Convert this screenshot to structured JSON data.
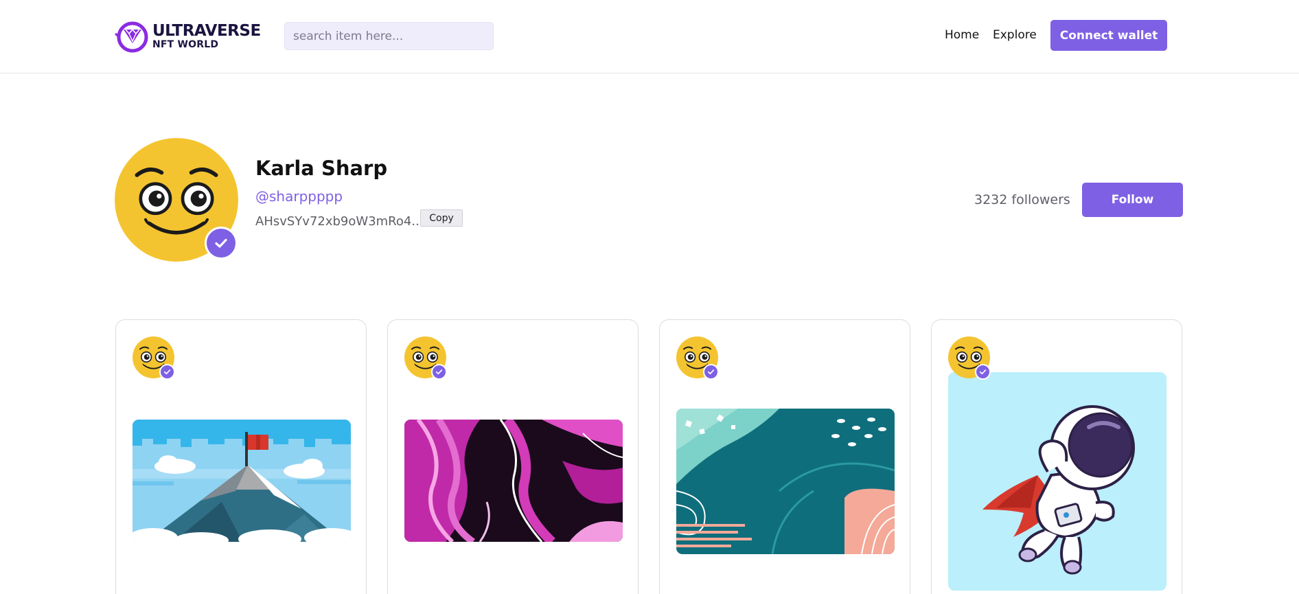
{
  "header": {
    "logo": {
      "title": "ULTRAVERSE",
      "subtitle": "NFT WORLD"
    },
    "search": {
      "placeholder": "search item here..."
    },
    "nav": {
      "home": "Home",
      "explore": "Explore"
    },
    "connect_wallet_label": "Connect wallet"
  },
  "profile": {
    "name": "Karla Sharp",
    "handle": "@sharppppp",
    "address": "AHsvSYv72xb9oW3mRo4...",
    "copy_label": "Copy",
    "followers_text": "3232 followers",
    "follow_label": "Follow",
    "verified": true
  },
  "cards": [
    {
      "artwork": "pixel-mountain-with-flag",
      "creator_verified": true
    },
    {
      "artwork": "pink-marble-abstract",
      "creator_verified": true
    },
    {
      "artwork": "teal-abstract-shapes",
      "creator_verified": true
    },
    {
      "artwork": "astronaut-superhero",
      "creator_verified": true
    }
  ],
  "colors": {
    "accent": "#7e60e4",
    "search_bg": "#efedfb",
    "avatar_yellow": "#f4c430",
    "text_dark": "#111111",
    "text_muted": "#5d5d66"
  },
  "icons": {
    "logo": "diamond-ring-logo-icon",
    "verified": "check-icon",
    "avatar": "smiley-face-icon"
  }
}
